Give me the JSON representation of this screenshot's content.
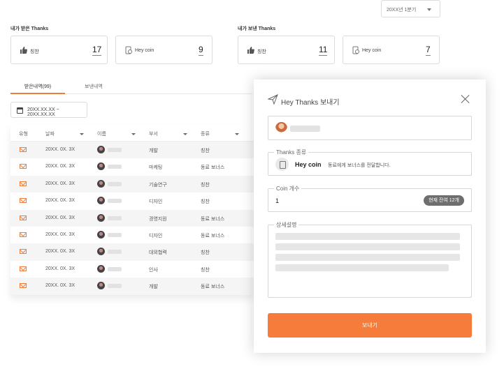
{
  "period": {
    "value": "20XX년 1분기"
  },
  "received": {
    "title": "내가 받은 Thanks",
    "cards": [
      {
        "icon": "thumbs-up-icon",
        "label": "칭찬",
        "value": "17"
      },
      {
        "icon": "coin-icon",
        "label": "Hey coin",
        "value": "9"
      }
    ]
  },
  "sent": {
    "title": "내가 보낸 Thanks",
    "cards": [
      {
        "icon": "thumbs-up-icon",
        "label": "칭찬",
        "value": "11"
      },
      {
        "icon": "coin-icon",
        "label": "Hey coin",
        "value": "7"
      }
    ]
  },
  "tabs": [
    {
      "label": "받은내역(99)",
      "active": true
    },
    {
      "label": "보낸내역",
      "active": false
    }
  ],
  "date_range": {
    "value": "20XX.XX.XX ~ 20XX.XX.XX"
  },
  "table": {
    "columns": [
      "유형",
      "날짜",
      "이름",
      "부서",
      "종류"
    ],
    "rows": [
      {
        "date": "20XX. 0X. 3X",
        "dept": "개발",
        "kind": "칭찬"
      },
      {
        "date": "20XX. 0X. 3X",
        "dept": "마케팅",
        "kind": "동료 보너스"
      },
      {
        "date": "20XX. 0X. 3X",
        "dept": "기술연구",
        "kind": "칭찬"
      },
      {
        "date": "20XX. 0X. 3X",
        "dept": "디자인",
        "kind": "칭찬"
      },
      {
        "date": "20XX. 0X. 3X",
        "dept": "경영지원",
        "kind": "동료 보너스"
      },
      {
        "date": "20XX. 0X. 3X",
        "dept": "디자인",
        "kind": "동료 보너스"
      },
      {
        "date": "20XX. 0X. 3X",
        "dept": "대외협력",
        "kind": "칭찬"
      },
      {
        "date": "20XX. 0X. 3X",
        "dept": "인사",
        "kind": "칭찬"
      },
      {
        "date": "20XX. 0X. 3X",
        "dept": "개발",
        "kind": "동료 보너스"
      }
    ]
  },
  "modal": {
    "title": "Hey Thanks 보내기",
    "kind_label": "Thanks 종류",
    "kind_name": "Hey coin",
    "kind_desc": "동료에게 보너스를 전달합니다.",
    "count_label": "Coin 개수",
    "count_value": "1",
    "balance_badge": "현재 잔여 12개",
    "detail_label": "상세설명",
    "submit_label": "보내기"
  },
  "colors": {
    "accent": "#f57c3a",
    "link_underline": "#4a90e2",
    "badge": "#6e6e6e"
  }
}
